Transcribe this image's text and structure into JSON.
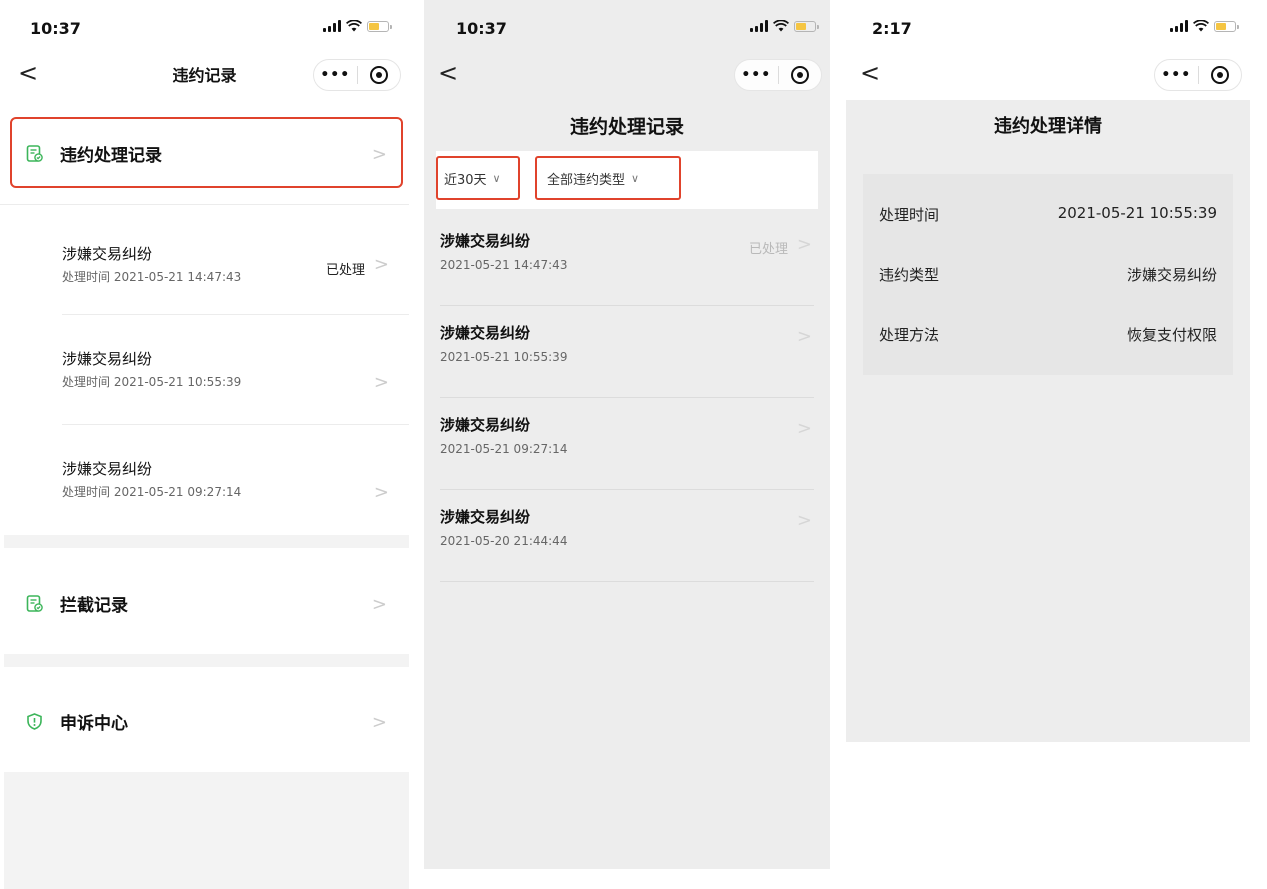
{
  "screen1": {
    "time": "10:37",
    "back": "<",
    "title": "违约记录",
    "capsule_more": "•••",
    "menu": [
      {
        "label": "违约处理记录"
      },
      {
        "label": "拦截记录"
      },
      {
        "label": "申诉中心"
      }
    ],
    "records": [
      {
        "title": "涉嫌交易纠纷",
        "time": "处理时间 2021-05-21 14:47:43",
        "status": "已处理"
      },
      {
        "title": "涉嫌交易纠纷",
        "time": "处理时间 2021-05-21 10:55:39",
        "status": ""
      },
      {
        "title": "涉嫌交易纠纷",
        "time": "处理时间 2021-05-21 09:27:14",
        "status": ""
      }
    ],
    "chevron": ">"
  },
  "screen2": {
    "time": "10:37",
    "back": "<",
    "capsule_more": "•••",
    "title": "违约处理记录",
    "filter_time": "近30天",
    "filter_type": "全部违约类型",
    "dropdown_glyph": "∨",
    "records": [
      {
        "title": "涉嫌交易纠纷",
        "time": "2021-05-21 14:47:43",
        "status": "已处理"
      },
      {
        "title": "涉嫌交易纠纷",
        "time": "2021-05-21 10:55:39",
        "status": ""
      },
      {
        "title": "涉嫌交易纠纷",
        "time": "2021-05-21 09:27:14",
        "status": ""
      },
      {
        "title": "涉嫌交易纠纷",
        "time": "2021-05-20 21:44:44",
        "status": ""
      }
    ],
    "chevron": ">"
  },
  "screen3": {
    "time": "2:17",
    "back": "<",
    "capsule_more": "•••",
    "title": "违约处理详情",
    "details": [
      {
        "key": "处理时间",
        "value": "2021-05-21 10:55:39"
      },
      {
        "key": "违约类型",
        "value": "涉嫌交易纠纷"
      },
      {
        "key": "处理方法",
        "value": "恢复支付权限"
      }
    ]
  },
  "colors": {
    "highlight_border": "#e0432c",
    "icon_green": "#3cb55a",
    "shield_green": "#3cb55a",
    "battery_yellow": "#f5c542"
  },
  "icons": [
    "document-check-icon",
    "shield-alert-icon",
    "chevron-right-icon",
    "back-arrow-icon",
    "more-dots-icon",
    "close-target-icon",
    "signal-icon",
    "wifi-icon",
    "battery-icon",
    "dropdown-arrow-icon"
  ]
}
